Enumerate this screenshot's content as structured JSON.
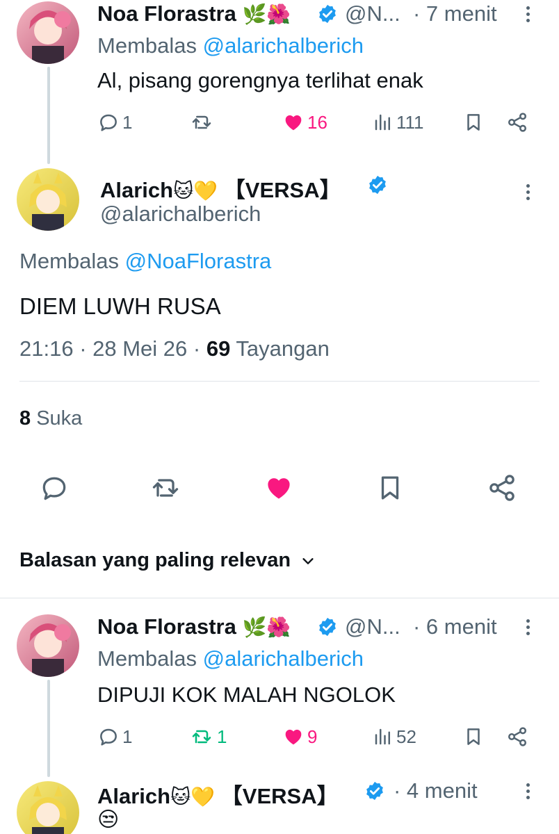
{
  "tweets": {
    "parent": {
      "name": "Noa Florastra",
      "name_emojis": "🌿🌺",
      "handle": "@N...",
      "time": "· 7 menit",
      "reply_prefix": "Membalas ",
      "reply_mention": "@alarichalberich",
      "text": "Al, pisang gorengnya terlihat enak",
      "replies": "1",
      "retweets": "",
      "likes": "16",
      "views": "111"
    },
    "focused": {
      "name": "Alarich",
      "name_emojis": "🐱💛",
      "name_suffix": "【VERSA】",
      "handle": "@alarichalberich",
      "reply_prefix": "Membalas ",
      "reply_mention": "@NoaFlorastra",
      "text": "DIEM LUWH RUSA",
      "time": "21:16",
      "date": "28 Mei 26",
      "views_count": "69",
      "views_label": "Tayangan",
      "likes_count": "8",
      "likes_label": "Suka"
    },
    "sort_label": "Balasan yang paling relevan",
    "reply1": {
      "name": "Noa Florastra",
      "name_emojis": "🌿🌺",
      "handle": "@N...",
      "time": "· 6 menit",
      "reply_prefix": "Membalas ",
      "reply_mention": "@alarichalberich",
      "text": "DIPUJI KOK MALAH NGOLOK",
      "replies": "1",
      "retweets": "1",
      "likes": "9",
      "views": "52"
    },
    "reply2": {
      "name": "Alarich",
      "name_emojis": "🐱💛",
      "name_suffix": "【VERSA】",
      "time": "· 4 menit",
      "text": "😒"
    }
  },
  "colors": {
    "accent": "#1d9bf0",
    "like": "#f91880",
    "retweet": "#00ba7c",
    "muted": "#536471",
    "text": "#0f1419"
  },
  "icons": [
    "reply-icon",
    "retweet-icon",
    "heart-icon",
    "views-icon",
    "bookmark-icon",
    "share-icon",
    "verified-badge-icon",
    "more-icon",
    "chevron-down-icon"
  ]
}
